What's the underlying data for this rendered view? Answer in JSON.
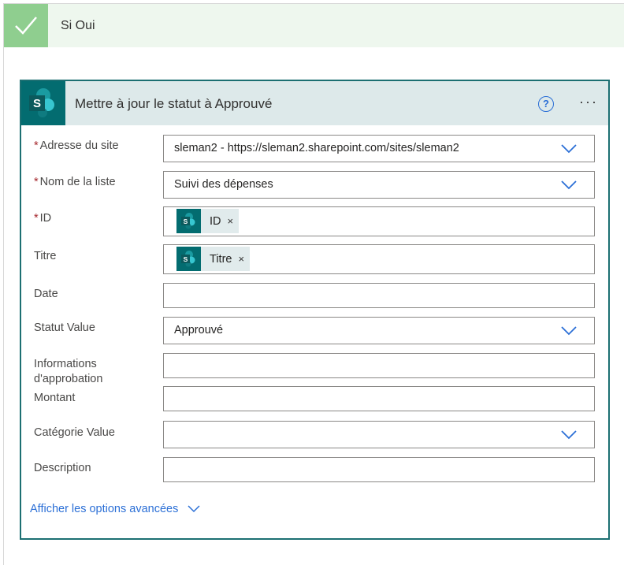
{
  "branch": {
    "title": "Si Oui"
  },
  "card": {
    "title": "Mettre à jour le statut à Approuvé",
    "help_glyph": "?",
    "more_glyph": "···",
    "icon": "sharepoint-icon"
  },
  "fields": {
    "site": {
      "label": "Adresse du site",
      "required": true,
      "value": "sleman2 - https://sleman2.sharepoint.com/sites/sleman2"
    },
    "list": {
      "label": "Nom de la liste",
      "required": true,
      "value": "Suivi des dépenses"
    },
    "id": {
      "label": "ID",
      "required": true,
      "token": "ID"
    },
    "titre": {
      "label": "Titre",
      "required": false,
      "token": "Titre"
    },
    "date": {
      "label": "Date",
      "required": false,
      "value": ""
    },
    "statut": {
      "label": "Statut Value",
      "required": false,
      "value": "Approuvé"
    },
    "infos": {
      "label_line1": "Informations",
      "label_line2": "d'approbation",
      "required": false,
      "value": ""
    },
    "montant": {
      "label": "Montant",
      "required": false,
      "value": ""
    },
    "categorie": {
      "label": "Catégorie Value",
      "required": false,
      "value": ""
    },
    "description": {
      "label": "Description",
      "required": false,
      "value": ""
    }
  },
  "required_marker": "*",
  "token_close": "×",
  "advanced_link": "Afficher les options avancées",
  "colors": {
    "accent": "#2b6fd6",
    "sharepoint": "#036c70",
    "success": "#8fce8f",
    "card_border": "#1c6f72",
    "required": "#a4262c"
  }
}
